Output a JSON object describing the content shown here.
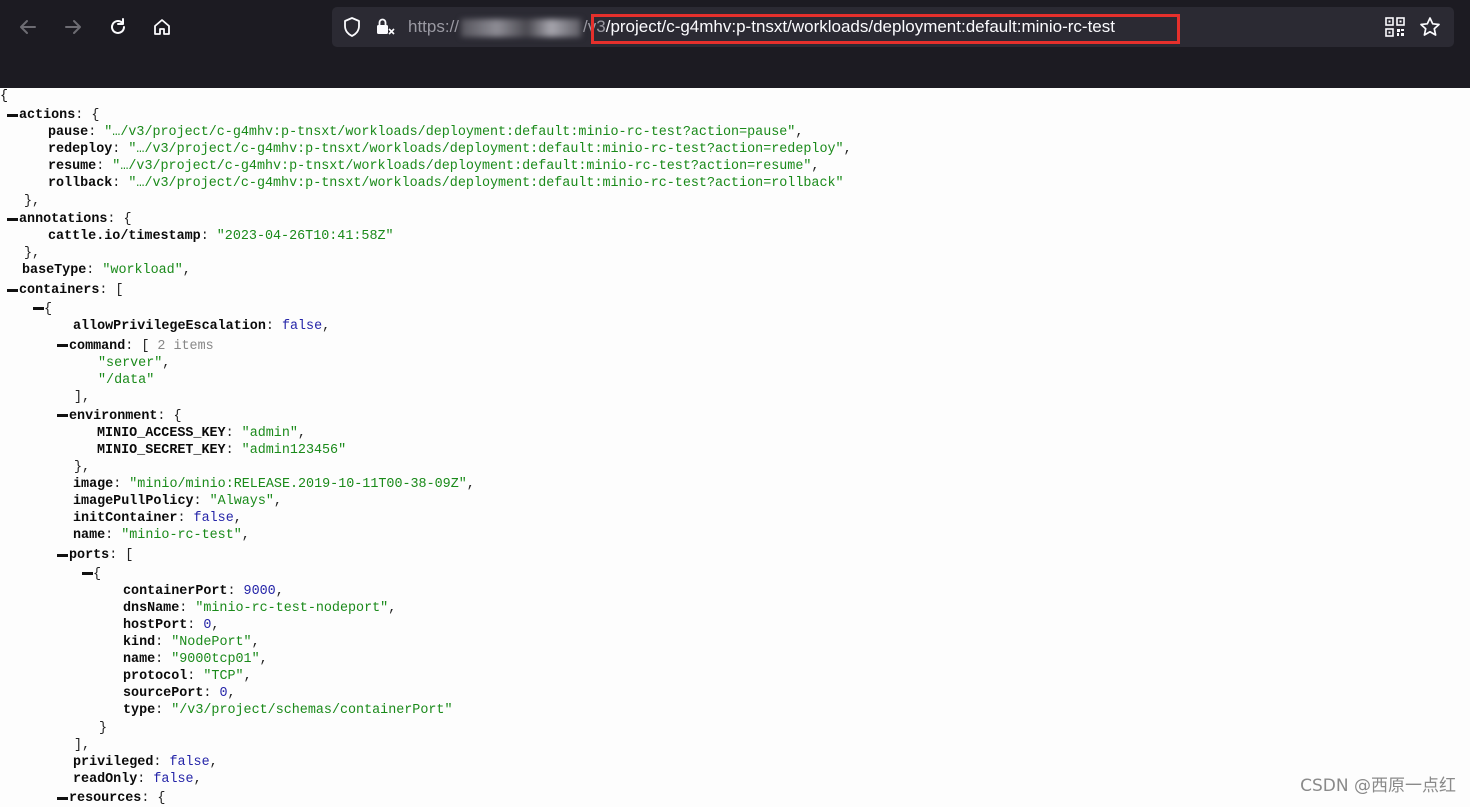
{
  "browser": {
    "url_prefix": "https://",
    "url_mid": "/v3",
    "url_highlighted": "/project/c-g4mhv:p-tnsxt/workloads/deployment:default:minio-rc-test",
    "icons": [
      "back-arrow-icon",
      "forward-arrow-icon",
      "reload-icon",
      "home-icon",
      "shield-icon",
      "lock-icon",
      "qr-code-icon",
      "bookmark-star-icon"
    ],
    "highlight_color": "#e5302c"
  },
  "json": {
    "open_brace": "{",
    "actions_key": "actions",
    "pause_key": "pause",
    "pause_val": "\"…/v3/project/c-g4mhv:p-tnsxt/workloads/deployment:default:minio-rc-test?action=pause\"",
    "redeploy_key": "redeploy",
    "redeploy_val": "\"…/v3/project/c-g4mhv:p-tnsxt/workloads/deployment:default:minio-rc-test?action=redeploy\"",
    "resume_key": "resume",
    "resume_val": "\"…/v3/project/c-g4mhv:p-tnsxt/workloads/deployment:default:minio-rc-test?action=resume\"",
    "rollback_key": "rollback",
    "rollback_val": "\"…/v3/project/c-g4mhv:p-tnsxt/workloads/deployment:default:minio-rc-test?action=rollback\"",
    "annotations_key": "annotations",
    "timestamp_key": "cattle.io/timestamp",
    "timestamp_val": "\"2023-04-26T10:41:58Z\"",
    "basetype_key": "baseType",
    "basetype_val": "\"workload\"",
    "containers_key": "containers",
    "ape_key": "allowPrivilegeEscalation",
    "ape_val": "false",
    "command_key": "command",
    "command_count": "2 items",
    "command_item1": "\"server\"",
    "command_item2": "\"/data\"",
    "environment_key": "environment",
    "access_key_key": "MINIO_ACCESS_KEY",
    "access_key_val": "\"admin\"",
    "secret_key_key": "MINIO_SECRET_KEY",
    "secret_key_val": "\"admin123456\"",
    "image_key": "image",
    "image_val": "\"minio/minio:RELEASE.2019-10-11T00-38-09Z\"",
    "pullpolicy_key": "imagePullPolicy",
    "pullpolicy_val": "\"Always\"",
    "initcontainer_key": "initContainer",
    "initcontainer_val": "false",
    "name_key": "name",
    "name_val": "\"minio-rc-test\"",
    "ports_key": "ports",
    "containerport_key": "containerPort",
    "containerport_val": "9000",
    "dnsname_key": "dnsName",
    "dnsname_val": "\"minio-rc-test-nodeport\"",
    "hostport_key": "hostPort",
    "hostport_val": "0",
    "kind_key": "kind",
    "kind_val": "\"NodePort\"",
    "portname_key": "name",
    "portname_val": "\"9000tcp01\"",
    "protocol_key": "protocol",
    "protocol_val": "\"TCP\"",
    "sourceport_key": "sourcePort",
    "sourceport_val": "0",
    "type_key": "type",
    "type_val": "\"/v3/project/schemas/containerPort\"",
    "privileged_key": "privileged",
    "privileged_val": "false",
    "readonly_key": "readOnly",
    "readonly_val": "false",
    "resources_key": "resources"
  },
  "watermark": "CSDN @西原一点红"
}
